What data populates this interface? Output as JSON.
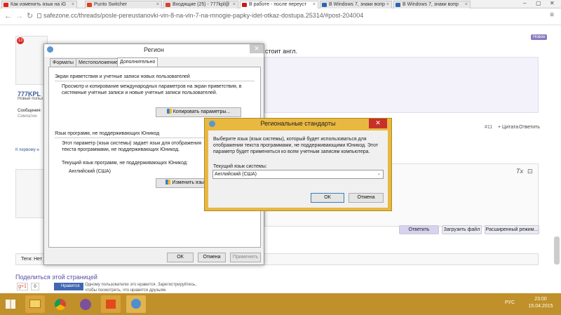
{
  "browser": {
    "tabs": [
      {
        "label": "Как изменить язык на iG",
        "icon_color": "#e62117"
      },
      {
        "label": "Punto Switcher",
        "icon_color": "#e0401a"
      },
      {
        "label": "Входящие (25) - 777kpl@",
        "icon_color": "#d44638"
      },
      {
        "label": "В работе - после переуст",
        "icon_color": "#c61a1a"
      },
      {
        "label": "В Windows 7, знаки вопр",
        "icon_color": "#2a67b1"
      },
      {
        "label": "В Windows 7, знаки вопр",
        "icon_color": "#2a67b1"
      }
    ],
    "url_domain": "safezone.cc",
    "url_path": "/threads/posle-pereustanovki-vin-8-na-vin-7-na-mnogie-papky-idet-otkaz-dostupa.25314/#post-204004"
  },
  "page": {
    "post_text": "стоит англ.",
    "badge_new": "Новое",
    "avatar_badge": "13",
    "user_name": "777KPL",
    "user_title": "Новый польз",
    "user_meta_1": "Сообщения",
    "user_meta_2": "Симпатии",
    "post_number": "#11",
    "quote": "+ Цитата",
    "reply": "Ответить",
    "to_first": "К первому н",
    "reply_btn": "Ответить",
    "upload_btn": "Загрузить файл",
    "advanced_btn": "Расширенный режим...",
    "tags_label": "Теги: Нет",
    "share_title": "Поделиться этой страницей",
    "gplus_count": "0",
    "like_btn": "Нравится",
    "like_text_1": "Одному пользователю это нравится. Зарегистрируйтесь,",
    "like_text_2": "чтобы посмотреть, что нравится друзьям."
  },
  "region_dialog": {
    "title": "Регион",
    "tabs": [
      "Форматы",
      "Местоположение",
      "Дополнительно"
    ],
    "welcome_group": "Экран приветствия и учетные записи новых пользователей",
    "welcome_desc": "Просмотр и копирование международных параметров на экран приветствия, в системные учетные записи и новые учетные записи пользователей.",
    "copy_btn": "Копировать параметры...",
    "nonunicode_group": "Язык программ, не поддерживающих Юникод",
    "nonunicode_desc": "Этот параметр (язык системы) задает язык для отображения текста программами, не поддерживающих Юникод.",
    "current_label": "Текущий язык программ, не поддерживающих Юникод:",
    "current_value": "Английский (США)",
    "change_btn": "Изменить язык системы...",
    "ok": "ОК",
    "cancel": "Отмена",
    "apply": "Применить"
  },
  "regional_standards": {
    "title": "Региональные стандарты",
    "desc": "Выберите язык (язык системы), который будет использоваться для отображения текста программами, не поддерживающими Юникод. Этот параметр будет применяться ко всем учетным записям компьютера.",
    "label": "Текущий язык системы:",
    "selected": "Английский (США)",
    "ok": "ОК",
    "cancel": "Отмена",
    "close": "✕"
  },
  "taskbar": {
    "lang": "РУС",
    "time": "23:00",
    "date": "15.04.2015"
  }
}
